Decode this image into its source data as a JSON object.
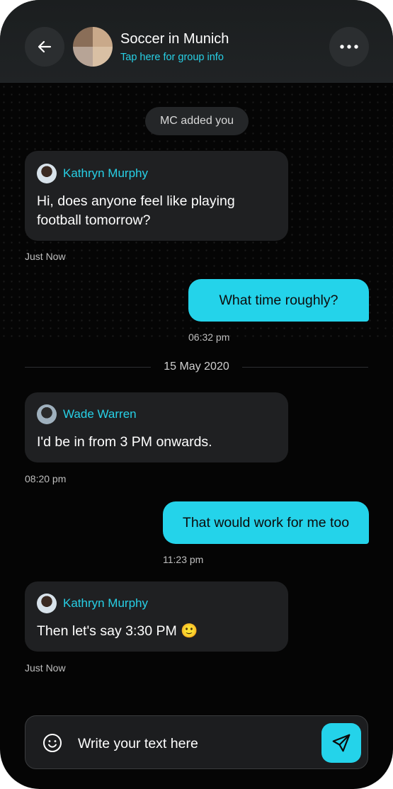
{
  "header": {
    "title": "Soccer in Munich",
    "subtitle": "Tap here for group info",
    "back_icon": "arrow-left-icon",
    "more_icon": "more-horizontal-icon"
  },
  "system_message": "MC added you",
  "messages": [
    {
      "direction": "incoming",
      "sender": "Kathryn Murphy",
      "text": "Hi, does anyone feel like playing football tomorrow?",
      "time": "Just Now"
    },
    {
      "direction": "outgoing",
      "text": "What time roughly?",
      "time": "06:32 pm"
    },
    {
      "direction": "incoming",
      "sender": "Wade Warren",
      "text": "I'd be in from 3 PM onwards.",
      "time": "08:20 pm"
    },
    {
      "direction": "outgoing",
      "text": "That would work for me too",
      "time": "11:23 pm"
    },
    {
      "direction": "incoming",
      "sender": "Kathryn Murphy",
      "text": "Then let's say 3:30 PM 🙂",
      "time": "Just Now"
    }
  ],
  "date_separator": "15 May 2020",
  "composer": {
    "placeholder": "Write your text here",
    "emoji_icon": "smile-icon",
    "send_icon": "send-icon"
  },
  "colors": {
    "accent": "#24d3ea",
    "background": "#050505",
    "bubble_incoming": "#1f2022"
  }
}
